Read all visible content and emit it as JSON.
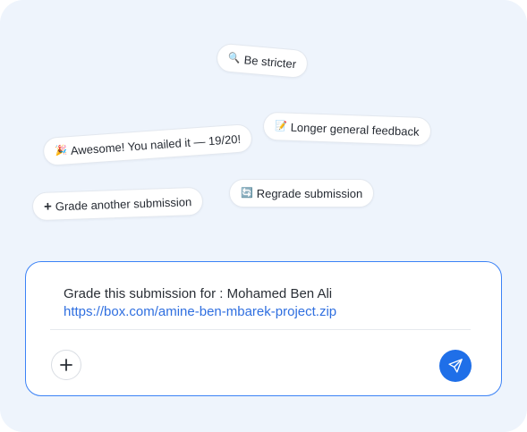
{
  "suggestions": {
    "be_stricter": {
      "emoji": "🔍",
      "label": "Be stricter"
    },
    "longer_feedback": {
      "emoji": "📝",
      "label": "Longer general feedback"
    },
    "awesome": {
      "emoji": "🎉",
      "label": "Awesome! You nailed it — 19/20!"
    },
    "grade_another": {
      "icon": "plus-icon",
      "label": "Grade another submission"
    },
    "regrade": {
      "emoji": "🔄",
      "label": "Regrade submission"
    }
  },
  "composer": {
    "message_line1": "Grade this submission for : Mohamed Ben Ali",
    "message_link": "https://box.com/amine-ben-mbarek-project.zip",
    "add_icon": "plus-icon",
    "send_icon": "send-icon"
  },
  "colors": {
    "background": "#eef4fc",
    "accent": "#1f6fe8",
    "link": "#2f6fe0",
    "border_focus": "#3b82f6"
  }
}
